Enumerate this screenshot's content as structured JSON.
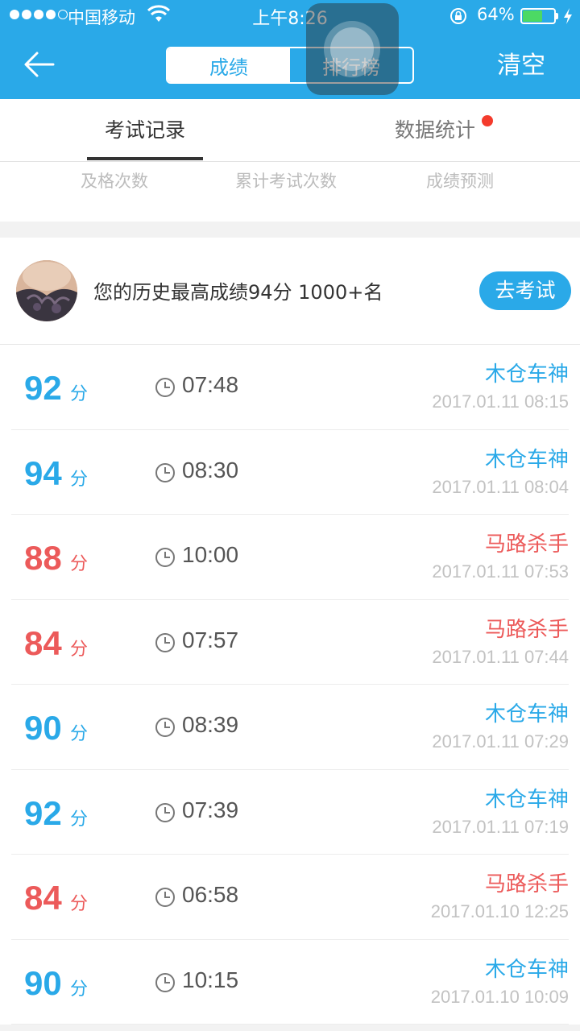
{
  "status_bar": {
    "carrier": "中国移动",
    "time": "上午8:26",
    "battery_percent": "64%",
    "battery_level": 0.64,
    "signal_bars": 4,
    "signal_total": 5
  },
  "header": {
    "segments": [
      {
        "label": "成绩",
        "active": true
      },
      {
        "label": "排行榜",
        "active": false
      }
    ],
    "clear_label": "清空"
  },
  "tabs": [
    {
      "label": "考试记录",
      "active": true
    },
    {
      "label": "数据统计",
      "active": false,
      "badge": true
    }
  ],
  "stats": {
    "labels": [
      "及格次数",
      "累计考试次数",
      "成绩预测"
    ]
  },
  "best": {
    "text": "您的历史最高成绩94分 1000+名",
    "button": "去考试"
  },
  "records": [
    {
      "score": "92",
      "unit": "分",
      "duration": "07:48",
      "title": "木仓车神",
      "date": "2017.01.11 08:15",
      "color": "#2aa9e8"
    },
    {
      "score": "94",
      "unit": "分",
      "duration": "08:30",
      "title": "木仓车神",
      "date": "2017.01.11 08:04",
      "color": "#2aa9e8"
    },
    {
      "score": "88",
      "unit": "分",
      "duration": "10:00",
      "title": "马路杀手",
      "date": "2017.01.11 07:53",
      "color": "#ec5a5a"
    },
    {
      "score": "84",
      "unit": "分",
      "duration": "07:57",
      "title": "马路杀手",
      "date": "2017.01.11 07:44",
      "color": "#ec5a5a"
    },
    {
      "score": "90",
      "unit": "分",
      "duration": "08:39",
      "title": "木仓车神",
      "date": "2017.01.11 07:29",
      "color": "#2aa9e8"
    },
    {
      "score": "92",
      "unit": "分",
      "duration": "07:39",
      "title": "木仓车神",
      "date": "2017.01.11 07:19",
      "color": "#2aa9e8"
    },
    {
      "score": "84",
      "unit": "分",
      "duration": "06:58",
      "title": "马路杀手",
      "date": "2017.01.10 12:25",
      "color": "#ec5a5a"
    },
    {
      "score": "90",
      "unit": "分",
      "duration": "10:15",
      "title": "木仓车神",
      "date": "2017.01.10 10:09",
      "color": "#2aa9e8"
    }
  ],
  "colors": {
    "accent": "#2aa9e8",
    "fail": "#ec5a5a",
    "badge": "#f43b2c"
  }
}
